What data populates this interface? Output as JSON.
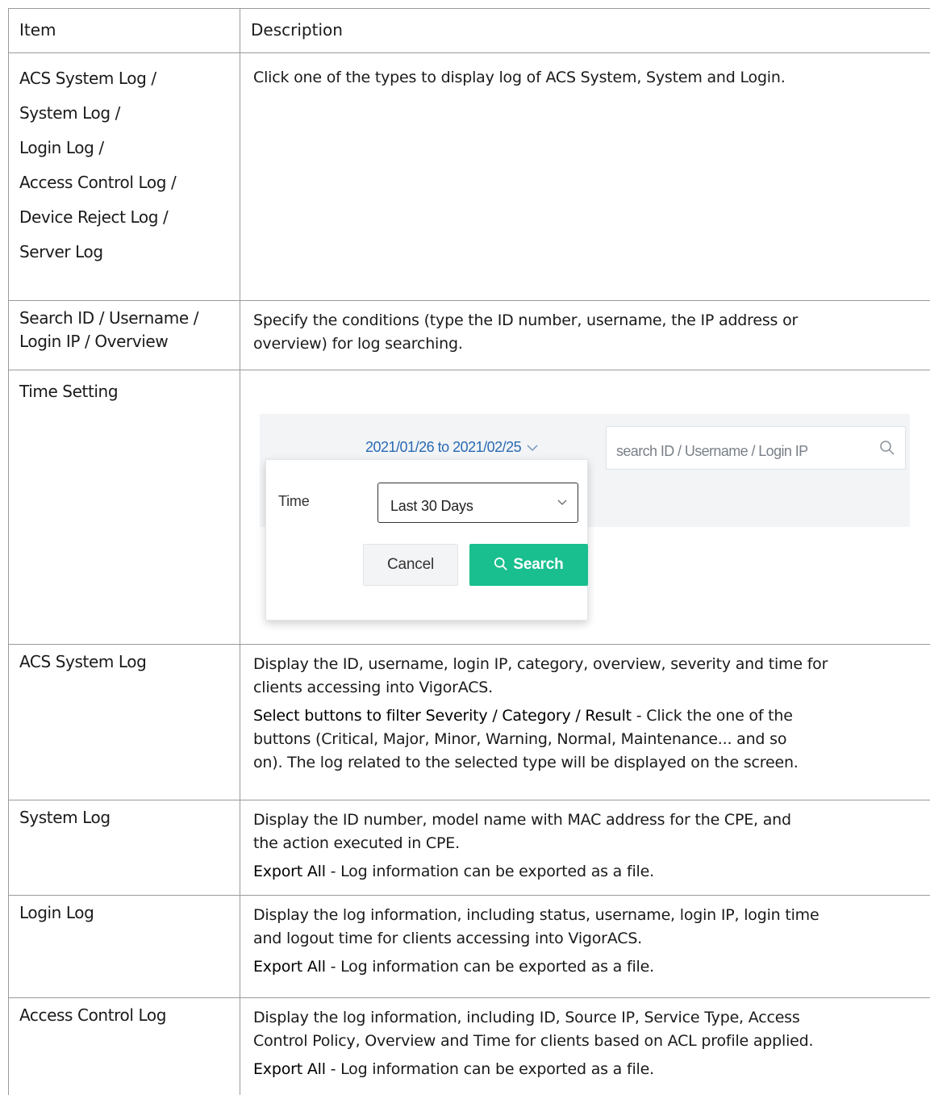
{
  "header": {
    "item": "Item",
    "description": "Description"
  },
  "rows": {
    "types": {
      "items": [
        "ACS System Log /",
        "System Log /",
        "Login Log /",
        "Access Control Log /",
        "Device Reject Log /",
        "Server Log"
      ],
      "desc": "Click one of the types to display log of ACS System, System and Login."
    },
    "search": {
      "item_lines": [
        "Search ID / Username /",
        "Login IP / Overview"
      ],
      "desc_lines": [
        "Specify the conditions (type the ID number, username, the IP address or",
        "overview) for log searching."
      ]
    },
    "time": {
      "item": "Time Setting",
      "screenshot": {
        "range": "2021/01/26 to 2021/02/25",
        "search_placeholder": "search ID / Username / Login IP",
        "time_label": "Time",
        "select_value": "Last 30 Days",
        "cancel": "Cancel",
        "search_btn": "Search",
        "accent_color": "#19bf8e"
      }
    },
    "acs": {
      "item": "ACS System Log",
      "p1": [
        "Display the ID, username, login IP, category, overview, severity and time for",
        "clients accessing into VigorACS."
      ],
      "p2_bold": "Select buttons to filter Severity / Category / Result",
      "p2": [
        " - Click the one of the",
        "buttons (Critical, Major, Minor, Warning, Normal, Maintenance... and so",
        "on). The log related to the selected type will be displayed on the screen."
      ]
    },
    "system": {
      "item": "System Log",
      "p1": [
        "Display the ID number, model name with MAC address for the CPE, and",
        "the action executed in CPE."
      ],
      "p2_bold": "Export All",
      "p2": " - Log information can be exported as a file."
    },
    "login": {
      "item": "Login Log",
      "p1": [
        "Display the log information, including status, username, login IP, login time",
        "and logout time for clients accessing into VigorACS."
      ],
      "p2_bold": "Export All",
      "p2": " - Log information can be exported as a file."
    },
    "access": {
      "item": "Access Control Log",
      "p1": [
        "Display the log information, including ID, Source IP, Service Type, Access",
        "Control Policy, Overview and Time for clients based on ACL profile applied."
      ],
      "p2_bold": "Export All",
      "p2": " - Log information can be exported as a file."
    }
  }
}
